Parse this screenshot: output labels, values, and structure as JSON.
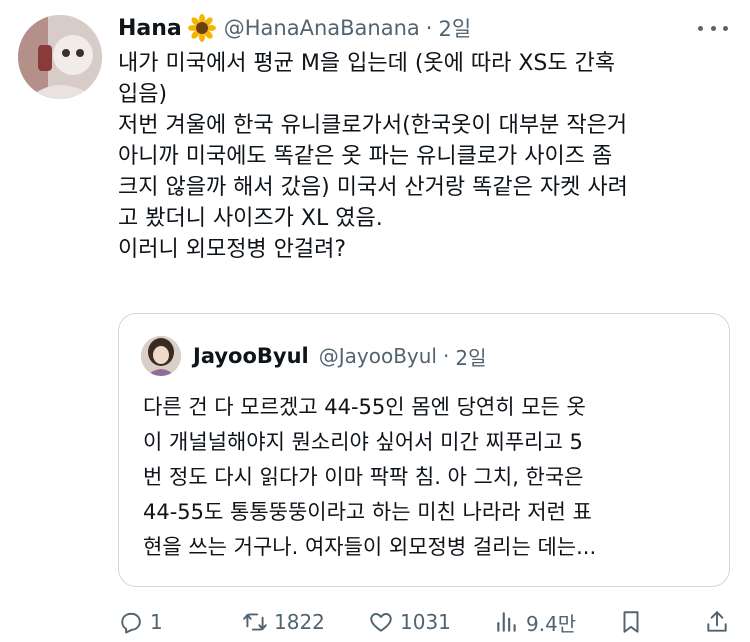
{
  "tweet": {
    "author_name": "Hana",
    "author_emoji": "sunflower-icon",
    "handle": "@HanaAnaBanana",
    "separator": "·",
    "time": "2일",
    "text_lines": [
      "내가 미국에서 평균 M을 입는데 (옷에 따라 XS도 간혹",
      "입음)",
      "저번 겨울에 한국 유니클로가서(한국옷이 대부분 작은거",
      "아니까 미국에도 똑같은 옷 파는 유니클로가 사이즈 좀",
      "크지 않을까 해서 갔음) 미국서 산거랑 똑같은 자켓 사려",
      "고 봤더니 사이즈가 XL 였음.",
      "이러니 외모정병 안걸려?"
    ]
  },
  "quote": {
    "author_name": "JayooByul",
    "handle": "@JayooByul",
    "separator": "·",
    "time": "2일",
    "text_lines": [
      "다른 건 다 모르겠고 44-55인 몸엔 당연히 모든 옷",
      "이 개널널해야지 뭔소리야 싶어서 미간 찌푸리고 5",
      "번 정도 다시 읽다가 이마 팍팍 침. 아 그치, 한국은",
      "44-55도 통통뚱뚱이라고 하는 미친 나라라 저런 표",
      "현을 쓰는 거구나. 여자들이 외모정병 걸리는 데는..."
    ]
  },
  "actions": {
    "reply_count": "1",
    "retweet_count": "1822",
    "like_count": "1031",
    "views_count": "9.4만"
  },
  "colors": {
    "text": "#0f1419",
    "secondary": "#536471",
    "border": "#cfd9de"
  }
}
